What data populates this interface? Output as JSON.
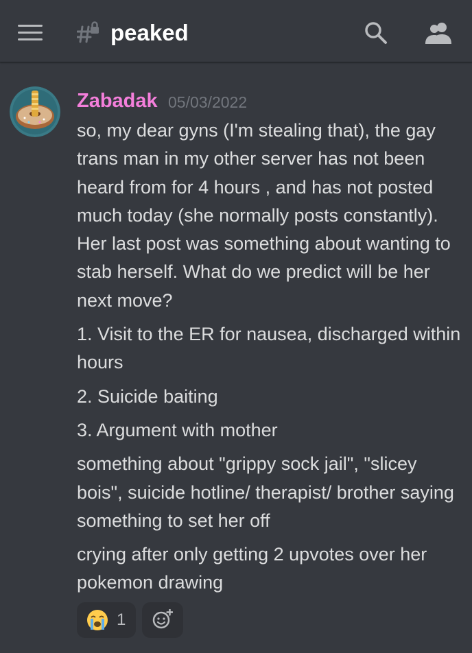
{
  "header": {
    "channel_name": "peaked",
    "menu_icon": "hamburger-menu-icon",
    "channel_icon": "locked-text-channel-icon",
    "search_icon": "search-icon",
    "members_icon": "members-icon"
  },
  "message": {
    "author": "Zabadak",
    "author_color": "#f47fdb",
    "timestamp": "05/03/2022",
    "paragraphs": [
      "so, my dear gyns (I'm stealing that), the gay trans man in my other server has not been heard from for 4 hours , and has not posted much today (she normally posts constantly). Her last post was something about wanting to stab herself. What do we predict will be her next move?",
      "1. Visit to the ER for nausea, discharged within hours",
      "2. Suicide baiting",
      "3. Argument with mother",
      "something about \"grippy sock jail\", \"slicey bois\", suicide hotline/ therapist/ brother saying something to set her off",
      "crying after only getting 2 upvotes over her pokemon drawing"
    ],
    "reaction": {
      "emoji": "loudly-crying-face-icon",
      "count": "1"
    },
    "add_reaction_icon": "add-reaction-icon"
  },
  "colors": {
    "background": "#36393f",
    "header_text": "#ffffff",
    "timestamp": "#72767d",
    "body_text": "#dcddde",
    "reaction_bg": "#2f3136"
  }
}
